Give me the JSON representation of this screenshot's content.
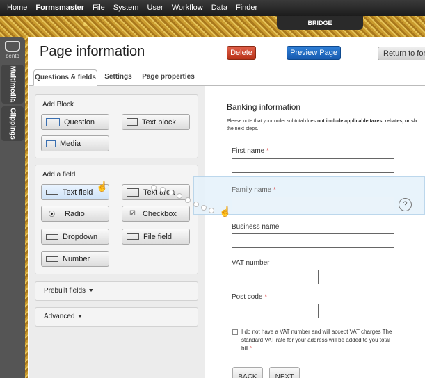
{
  "menubar": {
    "items": [
      "Home",
      "Formsmaster",
      "File",
      "System",
      "User",
      "Workflow",
      "Data",
      "Finder"
    ]
  },
  "bridge_tab": "BRIDGE",
  "dock": {
    "logo_label": "bento",
    "tabs": [
      "Multimedia",
      "Clippings"
    ]
  },
  "header": {
    "title": "Page information",
    "delete_label": "Delete",
    "preview_label": "Preview Page",
    "return_label": "Return to form"
  },
  "tabs": [
    "Questions & fields",
    "Settings",
    "Page properties"
  ],
  "add_block": {
    "title": "Add Block",
    "buttons": [
      "Question",
      "Text block",
      "Media"
    ]
  },
  "add_field": {
    "title": "Add a field",
    "buttons": [
      "Text field",
      "Text area",
      "Radio",
      "Checkbox",
      "Dropdown",
      "File field",
      "Number"
    ]
  },
  "prebuilt_label": "Prebuilt fields",
  "advanced_label": "Advanced",
  "form": {
    "title": "Banking information",
    "notice_prefix": "Please note that your order subtotal does ",
    "notice_bold": "not include applicable taxes, rebates, or sh",
    "notice_suffix": "the next steps.",
    "fields": [
      "First name",
      "Family name",
      "Business name",
      "VAT number",
      "Post code"
    ],
    "required_mark": "*",
    "help_icon": "?",
    "checkbox_label": "I do not have a VAT number and will accept VAT charges The standard VAT rate for your address will be added to you total bill",
    "back_label": "BACK",
    "next_label": "NEXT"
  },
  "colors": {
    "delete": "#c2401f",
    "preview": "#1f6cc4",
    "menubar": "#262626",
    "highlight": "#e6f2fb"
  }
}
